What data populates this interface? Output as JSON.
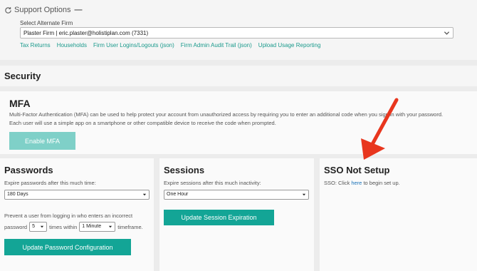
{
  "support": {
    "title": "Support Options",
    "collapse": "—",
    "alt_firm_label": "Select Alternate Firm",
    "alt_firm_value": "Plaster Firm | eric.plaster@holistiplan.com (7331)",
    "links": [
      "Tax Returns",
      "Households",
      "Firm User Logins/Logouts (json)",
      "Firm Admin Audit Trail (json)",
      "Upload Usage Reporting"
    ]
  },
  "security": {
    "heading": "Security"
  },
  "mfa": {
    "heading": "MFA",
    "line1": "Multi-Factor Authentication (MFA) can be used to help protect your account from unauthorized access by requiring you to enter an additional code when you sign in with your password.",
    "line2": "Each user will use a simple app on a smartphone or other compatible device to receive the code when prompted.",
    "button": "Enable MFA"
  },
  "passwords": {
    "heading": "Passwords",
    "expire_label": "Expire passwords after this much time:",
    "expire_value": "180 Days",
    "lockout_text": "Prevent a user from logging in who enters an incorrect",
    "lockout_prefix": "password",
    "attempts_value": "5",
    "times_within": "times within",
    "window_value": "1 Minute",
    "timeframe": "timeframe.",
    "button": "Update Password Configuration"
  },
  "sessions": {
    "heading": "Sessions",
    "expire_label": "Expire sessions after this much inactivity:",
    "expire_value": "One Hour",
    "button": "Update Session Expiration"
  },
  "sso": {
    "heading": "SSO Not Setup",
    "prefix": "SSO: Click ",
    "link": "here",
    "suffix": " to begin set up."
  },
  "colors": {
    "accent": "#13a596",
    "accent_disabled": "#7fd0c8",
    "link": "#1a9a8c",
    "annotation_arrow": "#e8361e"
  }
}
